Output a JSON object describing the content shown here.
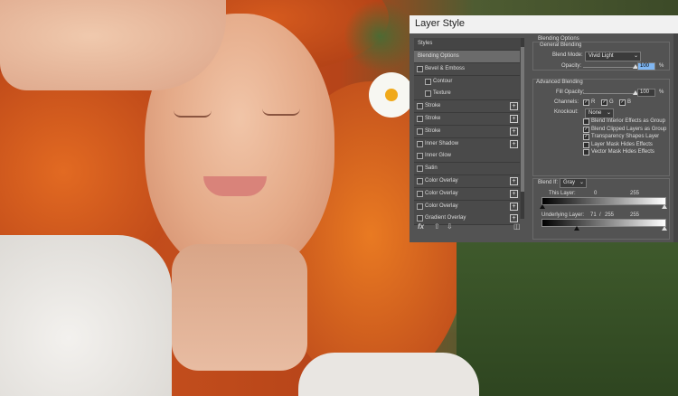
{
  "dialog": {
    "title": "Layer Style",
    "styles_header": "Styles",
    "styles": [
      {
        "label": "Blending Options",
        "has_checkbox": false,
        "has_plus": false,
        "indent": false,
        "active": true
      },
      {
        "label": "Bevel & Emboss",
        "has_checkbox": true,
        "has_plus": false,
        "indent": false
      },
      {
        "label": "Contour",
        "has_checkbox": true,
        "has_plus": false,
        "indent": true
      },
      {
        "label": "Texture",
        "has_checkbox": true,
        "has_plus": false,
        "indent": true
      },
      {
        "label": "Stroke",
        "has_checkbox": true,
        "has_plus": true,
        "indent": false
      },
      {
        "label": "Stroke",
        "has_checkbox": true,
        "has_plus": true,
        "indent": false
      },
      {
        "label": "Stroke",
        "has_checkbox": true,
        "has_plus": true,
        "indent": false
      },
      {
        "label": "Inner Shadow",
        "has_checkbox": true,
        "has_plus": true,
        "indent": false
      },
      {
        "label": "Inner Glow",
        "has_checkbox": true,
        "has_plus": false,
        "indent": false
      },
      {
        "label": "Satin",
        "has_checkbox": true,
        "has_plus": false,
        "indent": false
      },
      {
        "label": "Color Overlay",
        "has_checkbox": true,
        "has_plus": true,
        "indent": false
      },
      {
        "label": "Color Overlay",
        "has_checkbox": true,
        "has_plus": true,
        "indent": false
      },
      {
        "label": "Color Overlay",
        "has_checkbox": true,
        "has_plus": true,
        "indent": false
      },
      {
        "label": "Gradient Overlay",
        "has_checkbox": true,
        "has_plus": true,
        "indent": false
      }
    ],
    "footer": {
      "fx_label": "fx",
      "up_icon": "arrow-up-icon",
      "down_icon": "arrow-down-icon",
      "trash_icon": "trash-icon"
    },
    "blending": {
      "section_title": "Blending Options",
      "general_title": "General Blending",
      "blend_mode_label": "Blend Mode:",
      "blend_mode_value": "Vivid Light",
      "opacity_label": "Opacity:",
      "opacity_value": "100",
      "percent": "%",
      "advanced_title": "Advanced Blending",
      "fill_opacity_label": "Fill Opacity:",
      "fill_opacity_value": "100",
      "channels_label": "Channels:",
      "channel_r": "R",
      "channel_g": "G",
      "channel_b": "B",
      "knockout_label": "Knockout:",
      "knockout_value": "None",
      "options": [
        {
          "label": "Blend Interior Effects as Group",
          "checked": false
        },
        {
          "label": "Blend Clipped Layers as Group",
          "checked": true
        },
        {
          "label": "Transparency Shapes Layer",
          "checked": true
        },
        {
          "label": "Layer Mask Hides Effects",
          "checked": false
        },
        {
          "label": "Vector Mask Hides Effects",
          "checked": false
        }
      ],
      "blend_if_label": "Blend If:",
      "blend_if_value": "Gray",
      "this_layer_label": "This Layer:",
      "this_layer_low": "0",
      "this_layer_high": "255",
      "underlying_label": "Underlying Layer:",
      "underlying_low": "71",
      "underlying_slash": "/",
      "underlying_mid": "255",
      "underlying_high": "255",
      "opacity_level": 1.0,
      "fill_opacity_level": 1.0,
      "underlying_low_level": 0.28
    }
  }
}
